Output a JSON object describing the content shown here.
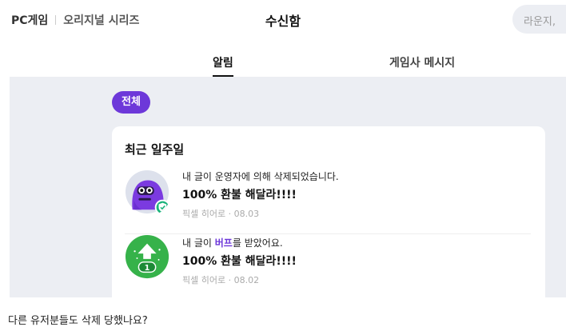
{
  "header": {
    "nav_pc_games": "PC게임",
    "nav_original_series": "오리지널 시리즈",
    "page_title": "수신함",
    "search_text": "라운지,"
  },
  "tabs": [
    {
      "label": "알림",
      "active": true
    },
    {
      "label": "게임사 메시지",
      "active": false
    }
  ],
  "filter": {
    "label": "전체"
  },
  "section": {
    "title": "최근 일주일"
  },
  "notifications": [
    {
      "message": "내 글이 운영자에 의해 삭제되었습니다.",
      "post_title": "100% 환불 해달라!!!!",
      "meta": "픽셀 히어로 · 08.03",
      "icon": "purple-monster-avatar"
    },
    {
      "message_before": "내 글이 ",
      "message_highlight": "버프",
      "message_after": "를 받았어요.",
      "post_title": "100% 환불 해달라!!!!",
      "meta": "픽셀 히어로 · 08.02",
      "icon": "buff-arrow-icon",
      "badge_count": "1"
    }
  ],
  "footer_text": "다른 유저분들도 삭제 당했나요?",
  "colors": {
    "accent": "#6d38d9",
    "panel_bg": "#eceef3",
    "buff_green": "#36b24a",
    "shield_green": "#19b37a"
  }
}
